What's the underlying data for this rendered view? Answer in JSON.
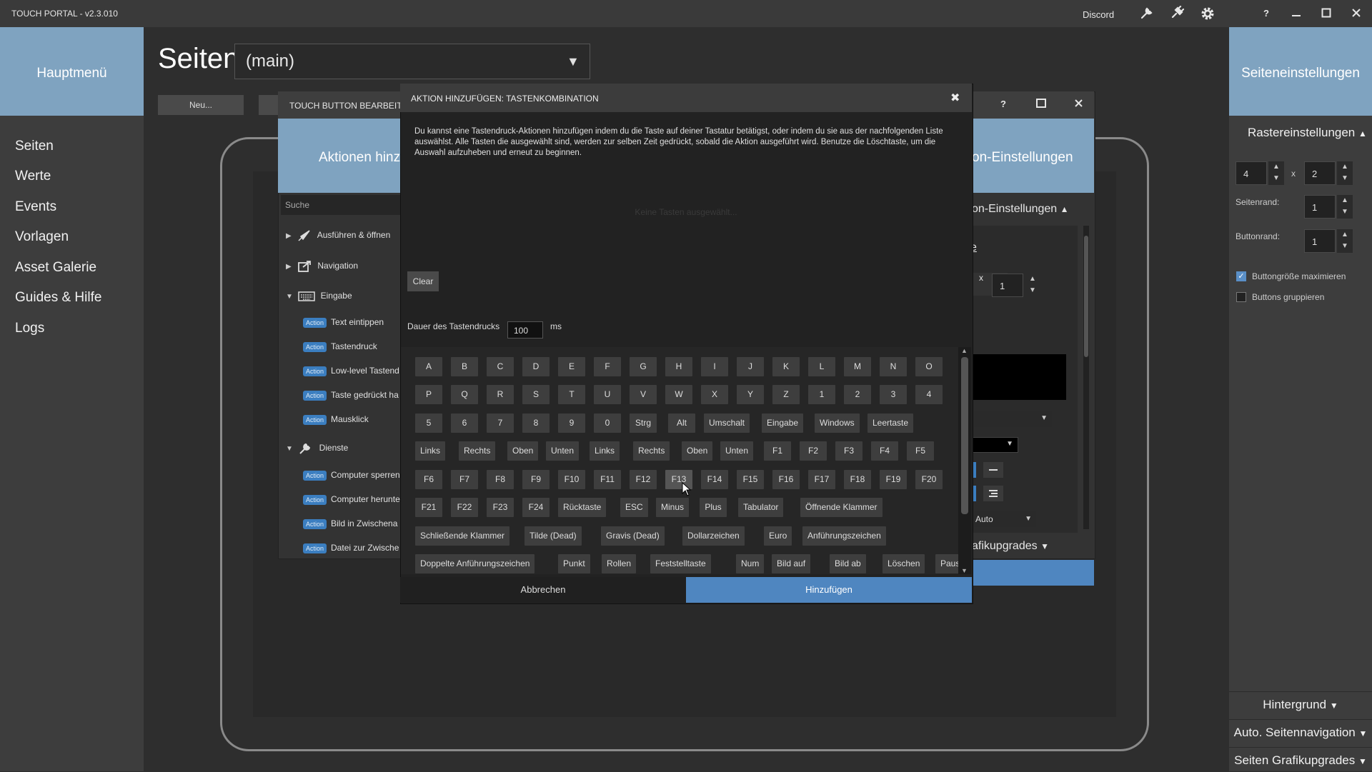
{
  "app": {
    "title": "TOUCH PORTAL - v2.3.010",
    "discord_label": "Discord"
  },
  "left_sidebar": {
    "title": "Hauptmenü",
    "items": [
      "Seiten",
      "Werte",
      "Events",
      "Vorlagen",
      "Asset Galerie",
      "Guides & Hilfe",
      "Logs"
    ]
  },
  "pages": {
    "heading": "Seiten",
    "selected_page": "(main)",
    "new_button": "Neu..."
  },
  "edit_window": {
    "title": "TOUCH BUTTON BEARBEITEN",
    "left_header": "Aktionen hinzufü",
    "right_header": "on-Einstellungen",
    "search_placeholder": "Suche",
    "tree": [
      {
        "label": "Ausführen & öffnen",
        "icon": "rocket-icon",
        "expanded": false
      },
      {
        "label": "Navigation",
        "icon": "navigation-icon",
        "expanded": false
      },
      {
        "label": "Eingabe",
        "icon": "keyboard-icon",
        "expanded": true,
        "actions": [
          "Text eintippen",
          "Tastendruck",
          "Low-level Tastend",
          "Taste gedrückt ha",
          "Mausklick"
        ]
      },
      {
        "label": "Dienste",
        "icon": "wrench-icon",
        "expanded": true,
        "actions": [
          "Computer sperren",
          "Computer herunte",
          "Bild in Zwischena",
          "Datei zur Zwische"
        ]
      }
    ],
    "action_badge": "Action",
    "right_panel": {
      "section_label": "on-Einstellungen",
      "partial_letter": "e",
      "x_label": "x",
      "value": "1",
      "auto_select": "Auto",
      "graphics_upgrades": "afikupgrades"
    }
  },
  "dialog": {
    "title": "AKTION HINZUFÜGEN: TASTENKOMBINATION",
    "description": "Du kannst eine Tastendruck-Aktionen hinzufügen indem du die Taste auf deiner Tastatur betätigst, oder indem du sie aus der nachfolgenden Liste auswählst. Alle Tasten die ausgewählt sind, werden zur selben Zeit gedrückt, sobald die Aktion ausgeführt wird. Benutze die Löschtaste, um die Auswahl aufzuheben und erneut zu beginnen.",
    "empty_text": "Keine Tasten ausgewählt...",
    "clear_button": "Clear",
    "duration_label": "Dauer des Tastendrucks",
    "duration_value": "100",
    "duration_unit": "ms",
    "key_rows": [
      [
        "A",
        "B",
        "C",
        "D",
        "E",
        "F",
        "G",
        "H",
        "I",
        "J",
        "K",
        "L",
        "M",
        "N",
        "O"
      ],
      [
        "P",
        "Q",
        "R",
        "S",
        "T",
        "U",
        "V",
        "W",
        "X",
        "Y",
        "Z",
        "1",
        "2",
        "3",
        "4"
      ],
      [
        "5",
        "6",
        "7",
        "8",
        "9",
        "0",
        "Strg",
        "Alt",
        "Umschalt",
        "Eingabe",
        "Windows",
        "Leertaste"
      ],
      [
        "Links",
        "Rechts",
        "Oben",
        "Unten",
        "Links",
        "Rechts",
        "Oben",
        "Unten",
        "F1",
        "F2",
        "F3",
        "F4",
        "F5"
      ],
      [
        "F6",
        "F7",
        "F8",
        "F9",
        "F10",
        "F11",
        "F12",
        "F13",
        "F14",
        "F15",
        "F16",
        "F17",
        "F18",
        "F19",
        "F20"
      ],
      [
        "F21",
        "F22",
        "F23",
        "F24",
        "Rücktaste",
        "ESC",
        "Minus",
        "Plus",
        "Tabulator",
        "Öffnende Klammer"
      ],
      [
        "Schließende Klammer",
        "Tilde (Dead)",
        "Gravis (Dead)",
        "Dollarzeichen",
        "Euro",
        "Anführungszeichen"
      ],
      [
        "Doppelte Anführungszeichen",
        "Punkt",
        "Rollen",
        "Feststelltaste",
        "Num",
        "Bild auf",
        "Bild ab",
        "Löschen",
        "Pause"
      ]
    ],
    "hovered_key": "F13",
    "cancel_button": "Abbrechen",
    "add_button": "Hinzufügen"
  },
  "right_sidebar": {
    "title": "Seiteneinstellungen",
    "grid_section": "Rastereinstellungen",
    "grid_cols": "4",
    "grid_x": "x",
    "grid_rows": "2",
    "page_margin_label": "Seitenrand:",
    "page_margin_value": "1",
    "button_margin_label": "Buttonrand:",
    "button_margin_value": "1",
    "maximize_label": "Buttongröße maximieren",
    "maximize_checked": true,
    "group_label": "Buttons gruppieren",
    "group_checked": false,
    "background_section": "Hintergrund",
    "auto_nav_section": "Auto. Seitennavigation",
    "graphics_section": "Seiten Grafikupgrades"
  },
  "colors": {
    "accent_blue": "#4f86c0",
    "header_blue": "#7fa3c0",
    "badge_blue": "#3b7ec0"
  }
}
